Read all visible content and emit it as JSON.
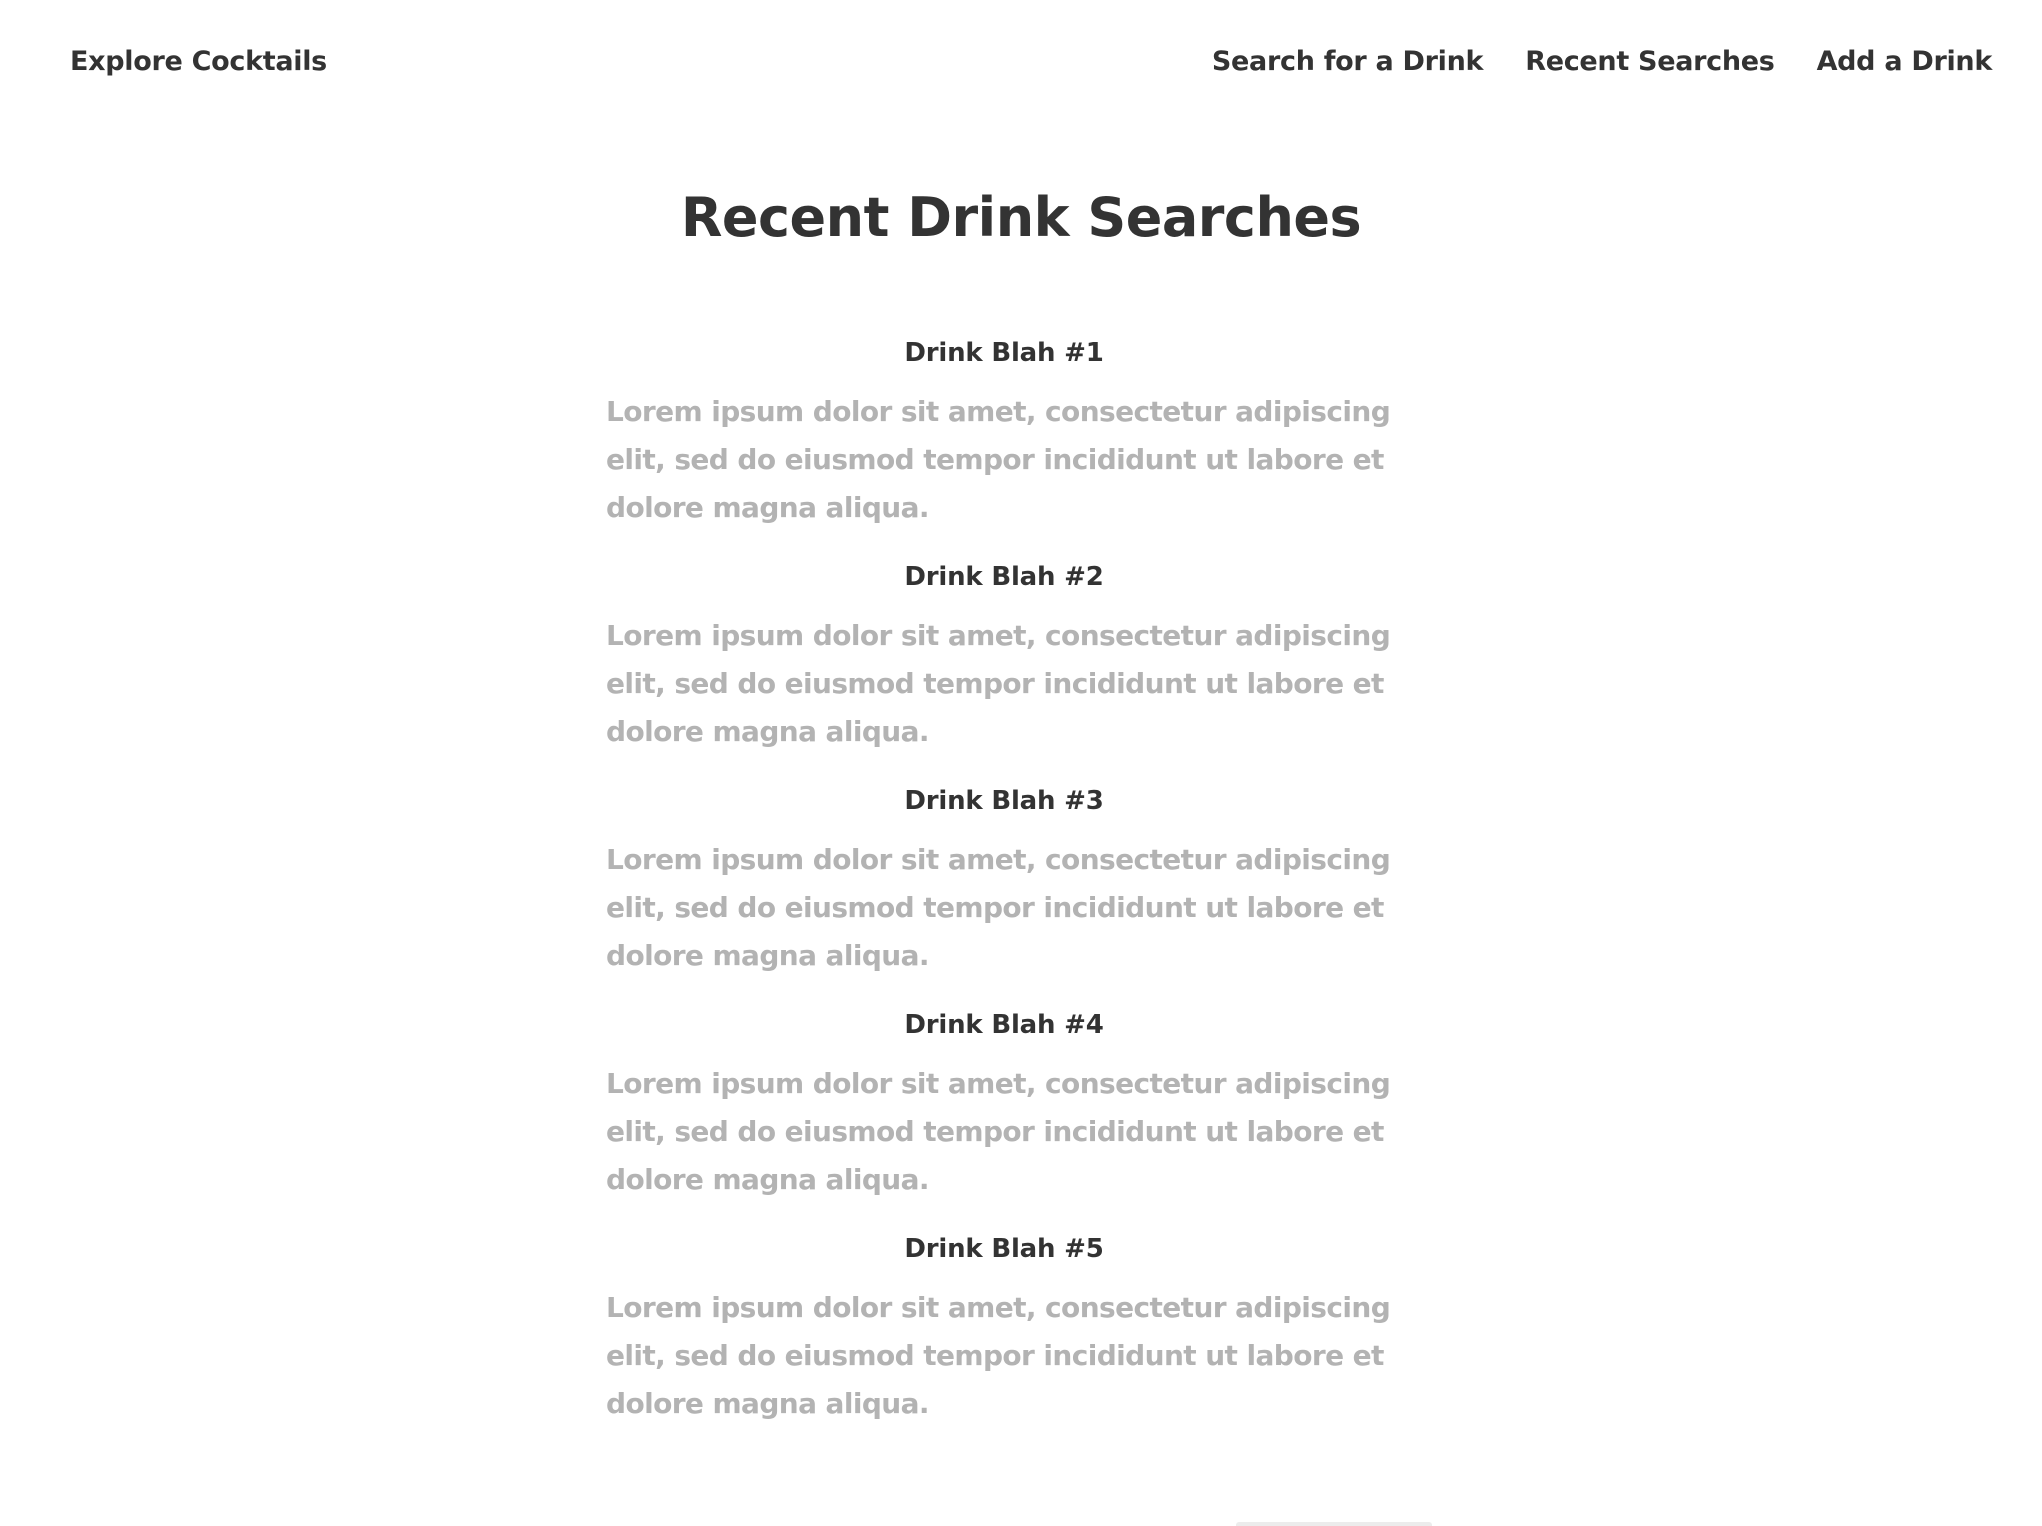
{
  "navbar": {
    "brand": "Explore Cocktails",
    "links": [
      {
        "label": "Search for a Drink"
      },
      {
        "label": "Recent Searches"
      },
      {
        "label": "Add a Drink"
      }
    ]
  },
  "main": {
    "title": "Recent Drink Searches",
    "results": [
      {
        "title": "Drink Blah #1",
        "description": "Lorem ipsum dolor sit amet, consectetur adipiscing elit, sed do eiusmod tempor incididunt ut labore et dolore magna aliqua."
      },
      {
        "title": "Drink Blah #2",
        "description": "Lorem ipsum dolor sit amet, consectetur adipiscing elit, sed do eiusmod tempor incididunt ut labore et dolore magna aliqua."
      },
      {
        "title": "Drink Blah #3",
        "description": "Lorem ipsum dolor sit amet, consectetur adipiscing elit, sed do eiusmod tempor incididunt ut labore et dolore magna aliqua."
      },
      {
        "title": "Drink Blah #4",
        "description": "Lorem ipsum dolor sit amet, consectetur adipiscing elit, sed do eiusmod tempor incididunt ut labore et dolore magna aliqua."
      },
      {
        "title": "Drink Blah #5",
        "description": "Lorem ipsum dolor sit amet, consectetur adipiscing elit, sed do eiusmod tempor incididunt ut labore et dolore magna aliqua."
      }
    ]
  }
}
